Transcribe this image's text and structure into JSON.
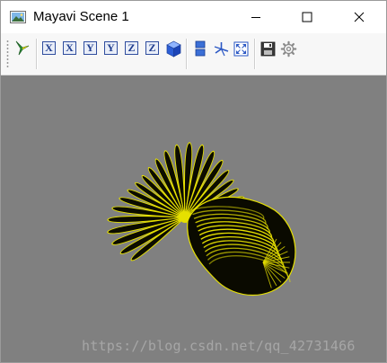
{
  "window": {
    "title": "Mayavi Scene 1"
  },
  "toolbar": {
    "buttons": [
      {
        "name": "view-isometric",
        "icon": "mayavi-logo-icon"
      },
      {
        "name": "view-x-plus",
        "label": "X"
      },
      {
        "name": "view-x-minus",
        "label": "X"
      },
      {
        "name": "view-y-plus",
        "label": "Y"
      },
      {
        "name": "view-y-minus",
        "label": "Y"
      },
      {
        "name": "view-z-plus",
        "label": "Z"
      },
      {
        "name": "view-z-minus",
        "label": "Z"
      },
      {
        "name": "view-isometric-cube",
        "icon": "cube-icon"
      },
      {
        "name": "toggle-parallel-projection",
        "icon": "projection-icon"
      },
      {
        "name": "toggle-axes-indicator",
        "icon": "axes-icon"
      },
      {
        "name": "full-screen",
        "icon": "fullscreen-icon"
      },
      {
        "name": "save-scene",
        "icon": "save-icon"
      },
      {
        "name": "configure-scene",
        "icon": "gear-icon"
      }
    ]
  },
  "viewport": {
    "background": "#808080",
    "object_color": "#e6e000",
    "watermark": "https://blog.csdn.net/qq_42731466"
  }
}
